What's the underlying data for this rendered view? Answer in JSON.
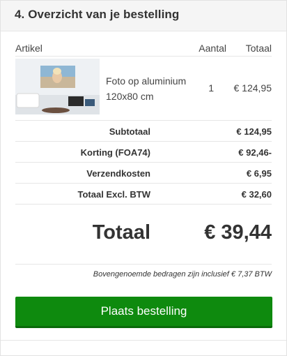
{
  "section": {
    "title": "4. Overzicht van je bestelling"
  },
  "columns": {
    "article": "Artikel",
    "quantity": "Aantal",
    "total": "Totaal"
  },
  "item": {
    "name_line1": "Foto op aluminium",
    "name_line2": "120x80 cm",
    "quantity": "1",
    "total": "€ 124,95",
    "thumbnail_icon": "product-photo-thumbnail"
  },
  "summary": [
    {
      "label": "Subtotaal",
      "value": "€ 124,95"
    },
    {
      "label": "Korting (FOA74)",
      "value": "€ 92,46-"
    },
    {
      "label": "Verzendkosten",
      "value": "€ 6,95"
    },
    {
      "label": "Totaal Excl. BTW",
      "value": "€ 32,60"
    }
  ],
  "grand_total": {
    "label": "Totaal",
    "value": "€ 39,44"
  },
  "vat_note": "Bovengenoemde bedragen zijn inclusief € 7,37 BTW",
  "order_button": {
    "label": "Plaats bestelling"
  },
  "colors": {
    "button": "#0e8a0e",
    "header_bg": "#f5f5f5",
    "text": "#333333"
  }
}
